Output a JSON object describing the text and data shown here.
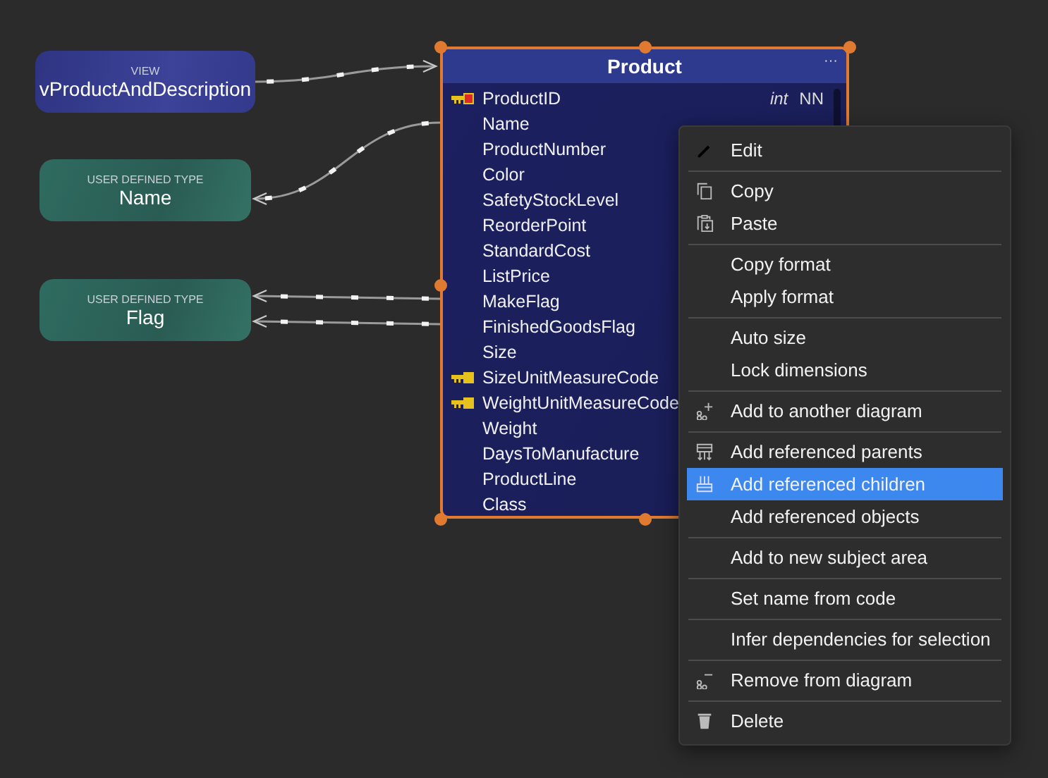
{
  "nodes": [
    {
      "kind": "view",
      "caption": "VIEW",
      "name": "vProductAndDescription"
    },
    {
      "kind": "udt",
      "caption": "USER DEFINED TYPE",
      "name": "Name"
    },
    {
      "kind": "udt",
      "caption": "USER DEFINED TYPE",
      "name": "Flag"
    }
  ],
  "entity": {
    "title": "Product",
    "more": "···",
    "columns": [
      {
        "name": "ProductID",
        "kind": "pk",
        "type": "int",
        "nn": "NN"
      },
      {
        "name": "Name",
        "kind": "plain"
      },
      {
        "name": "ProductNumber",
        "kind": "plain"
      },
      {
        "name": "Color",
        "kind": "plain"
      },
      {
        "name": "SafetyStockLevel",
        "kind": "plain"
      },
      {
        "name": "ReorderPoint",
        "kind": "plain"
      },
      {
        "name": "StandardCost",
        "kind": "plain"
      },
      {
        "name": "ListPrice",
        "kind": "plain"
      },
      {
        "name": "MakeFlag",
        "kind": "plain"
      },
      {
        "name": "FinishedGoodsFlag",
        "kind": "plain"
      },
      {
        "name": "Size",
        "kind": "plain"
      },
      {
        "name": "SizeUnitMeasureCode",
        "kind": "fk"
      },
      {
        "name": "WeightUnitMeasureCode",
        "kind": "fk"
      },
      {
        "name": "Weight",
        "kind": "plain"
      },
      {
        "name": "DaysToManufacture",
        "kind": "plain"
      },
      {
        "name": "ProductLine",
        "kind": "plain"
      },
      {
        "name": "Class",
        "kind": "plain"
      }
    ]
  },
  "context_menu": {
    "groups": [
      [
        {
          "label": "Edit",
          "kind": "edit",
          "selected": false
        }
      ],
      [
        {
          "label": "Copy",
          "kind": "copy",
          "selected": false
        },
        {
          "label": "Paste",
          "kind": "paste",
          "selected": false
        }
      ],
      [
        {
          "label": "Copy format",
          "kind": "plain",
          "selected": false
        },
        {
          "label": "Apply format",
          "kind": "plain",
          "selected": false
        }
      ],
      [
        {
          "label": "Auto size",
          "kind": "plain",
          "selected": false
        },
        {
          "label": "Lock dimensions",
          "kind": "plain",
          "selected": false
        }
      ],
      [
        {
          "label": "Add to another diagram",
          "kind": "add",
          "selected": false
        }
      ],
      [
        {
          "label": "Add referenced parents",
          "kind": "parents",
          "selected": false
        },
        {
          "label": "Add referenced children",
          "kind": "children",
          "selected": true
        },
        {
          "label": "Add referenced objects",
          "kind": "plain",
          "selected": false
        }
      ],
      [
        {
          "label": "Add to new subject area",
          "kind": "plain",
          "selected": false
        }
      ],
      [
        {
          "label": "Set name from code",
          "kind": "plain",
          "selected": false
        }
      ],
      [
        {
          "label": "Infer dependencies for selection",
          "kind": "plain",
          "selected": false
        }
      ],
      [
        {
          "label": "Remove from diagram",
          "kind": "remove",
          "selected": false
        }
      ],
      [
        {
          "label": "Delete",
          "kind": "delete",
          "selected": false
        }
      ]
    ]
  }
}
